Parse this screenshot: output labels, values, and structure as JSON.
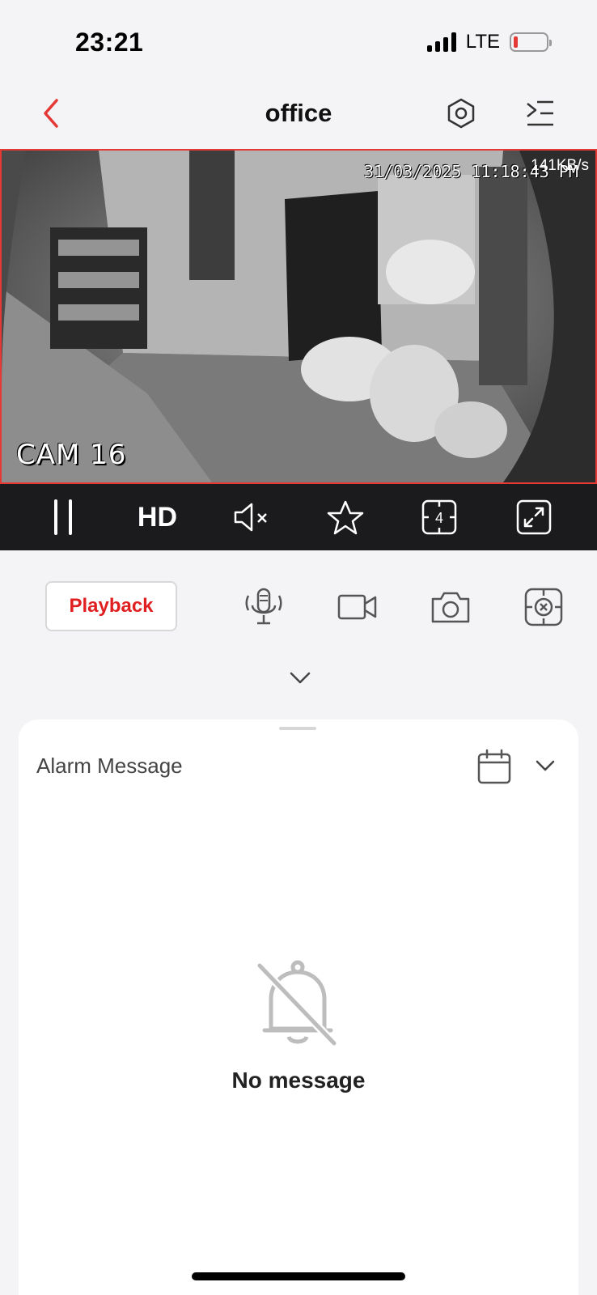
{
  "status_bar": {
    "time": "23:21",
    "network": "LTE",
    "battery_color": "#e53935"
  },
  "nav": {
    "title": "office",
    "back_icon": "chevron-left-icon",
    "settings_icon": "settings-hexagon-icon",
    "list_icon": "channel-list-icon",
    "accent": "#e53935"
  },
  "video": {
    "timestamp": "31/03/2025 11:18:43 PM",
    "bitrate": "141KB/s",
    "camera_label": "CAM 16"
  },
  "controls": {
    "pause_icon": "pause-icon",
    "quality_label": "HD",
    "mute_icon": "speaker-muted-icon",
    "favorite_icon": "star-icon",
    "split_count": "4",
    "fullscreen_icon": "fullscreen-icon"
  },
  "actions": {
    "playback_label": "Playback",
    "talk_icon": "microphone-icon",
    "record_icon": "video-record-icon",
    "snapshot_icon": "camera-snapshot-icon",
    "ptz_icon": "ptz-control-icon",
    "expand_icon": "chevron-down-icon"
  },
  "alarm_panel": {
    "title": "Alarm Message",
    "calendar_icon": "calendar-icon",
    "empty_text": "No message",
    "empty_icon": "bell-off-icon"
  }
}
